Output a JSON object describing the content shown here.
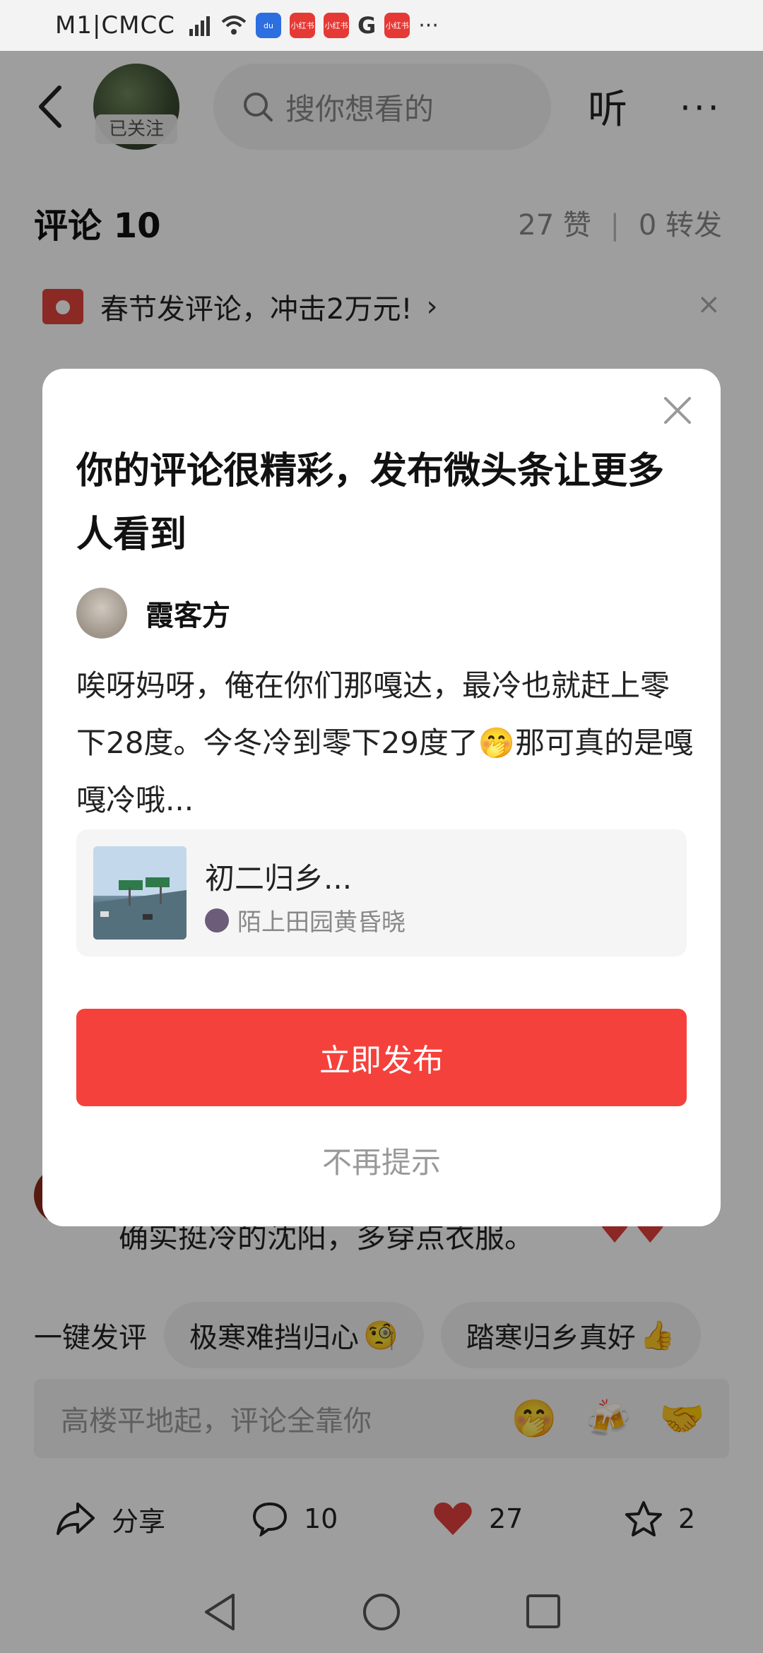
{
  "status_bar": {
    "carrier": "M1|CMCC",
    "more": "···",
    "g_icon": "G",
    "badge_text": "小红书"
  },
  "header": {
    "followed_tag": "已关注",
    "search_placeholder": "搜你想看的",
    "listen_label": "听",
    "more": "···"
  },
  "comments": {
    "title": "评论 10",
    "likes": "27 赞",
    "shares": "0 转发",
    "divider": "|"
  },
  "promo": {
    "text": "春节发评论，冲击2万元!",
    "arrow": "›",
    "close": "×"
  },
  "bg_comment": {
    "text": "确实挺冷的沈阳，多穿点衣服。",
    "hearts": "♥♥"
  },
  "quick_reply": {
    "label": "一键发评",
    "chips": [
      {
        "text": "极寒难挡归心",
        "emoji": "🧐"
      },
      {
        "text": "踏寒归乡真好",
        "emoji": "👍"
      }
    ]
  },
  "input_bar": {
    "placeholder": "高楼平地起，评论全靠你",
    "emojis": [
      "🤭",
      "🍻",
      "🤝"
    ]
  },
  "bottom_bar": {
    "share": "分享",
    "comments": "10",
    "likes": "27",
    "favorites": "2"
  },
  "dialog": {
    "title": "你的评论很精彩，发布微头条让更多人看到",
    "author": "霞客方",
    "body": "唉呀妈呀，俺在你们那嘎达，最冷也就赶上零下28度。今冬冷到零下29度了🤭那可真的是嘎嘎冷哦...",
    "card_title": "初二归乡...",
    "card_source": "陌上田园黄昏晓",
    "publish_button": "立即发布",
    "no_remind": "不再提示"
  },
  "colors": {
    "accent": "#f5413c",
    "heart": "#e0403c",
    "overlay": "rgba(0,0,0,0.38)"
  },
  "icons": [
    "back-arrow-icon",
    "search-icon",
    "close-icon",
    "share-icon",
    "comment-icon",
    "heart-icon",
    "star-icon",
    "nav-back-icon",
    "nav-home-icon",
    "nav-recents-icon"
  ]
}
